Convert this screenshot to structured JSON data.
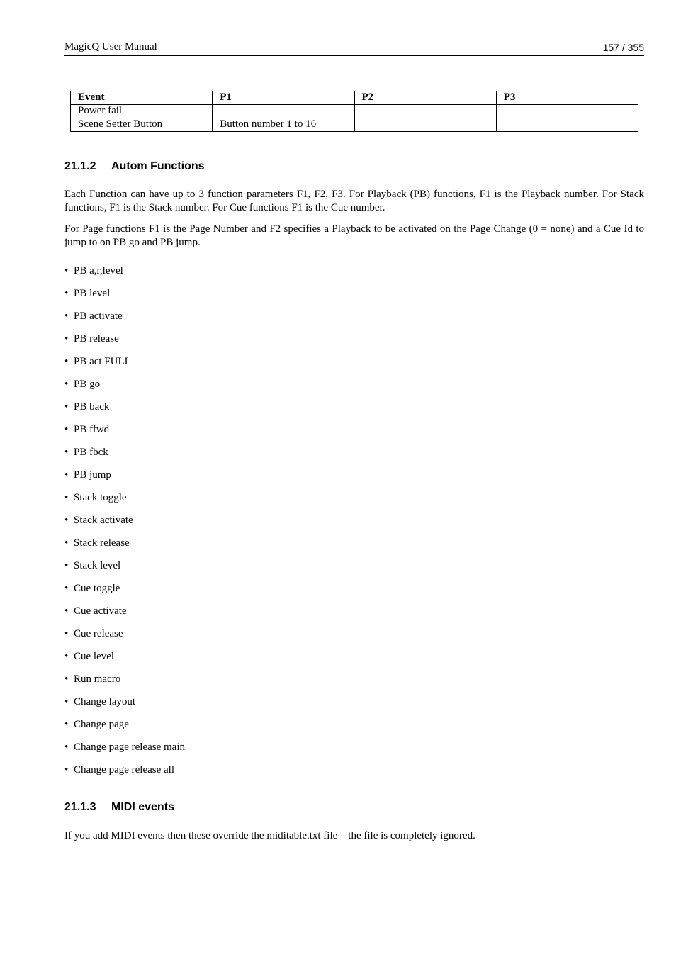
{
  "header": {
    "title": "MagicQ User Manual",
    "page": "157 / 355"
  },
  "event_table": {
    "columns": [
      "Event",
      "P1",
      "P2",
      "P3"
    ],
    "rows": [
      [
        "Power fail",
        "",
        "",
        ""
      ],
      [
        "Scene Setter Button",
        "Button number 1 to 16",
        "",
        ""
      ]
    ]
  },
  "section_autom": {
    "number": "21.1.2",
    "title": "Autom Functions",
    "paragraphs": [
      "Each Function can have up to 3 function parameters F1, F2, F3. For Playback (PB) functions, F1 is the Playback number. For Stack functions, F1 is the Stack number. For Cue functions F1 is the Cue number.",
      "For Page functions F1 is the Page Number and F2 specifies a Playback to be activated on the Page Change (0 = none) and a Cue Id to jump to on PB go and PB jump."
    ],
    "bullet_glyph": "•",
    "functions": [
      "PB a,r,level",
      "PB level",
      "PB activate",
      "PB release",
      "PB act FULL",
      "PB go",
      "PB back",
      "PB ffwd",
      "PB fbck",
      "PB jump",
      "Stack toggle",
      "Stack activate",
      "Stack release",
      "Stack level",
      "Cue toggle",
      "Cue activate",
      "Cue release",
      "Cue level",
      "Run macro",
      "Change layout",
      "Change page",
      "Change page release main",
      "Change page release all"
    ]
  },
  "section_midi": {
    "number": "21.1.3",
    "title": "MIDI events",
    "paragraph": "If you add MIDI events then these override the miditable.txt file – the file is completely ignored."
  }
}
